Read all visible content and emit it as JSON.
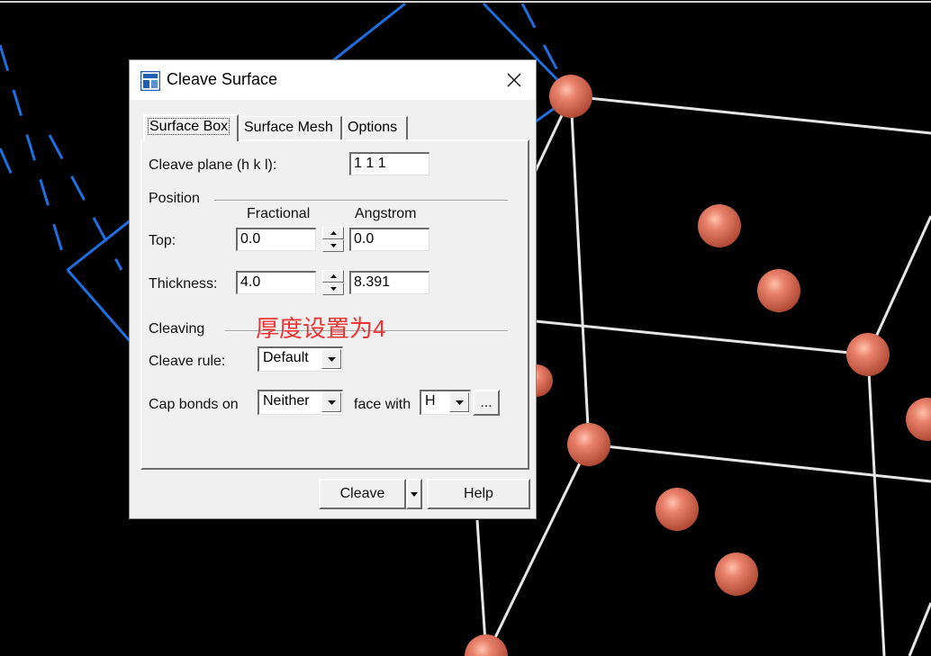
{
  "dialog": {
    "title": "Cleave Surface",
    "tabs": [
      {
        "label": "Surface Box",
        "active": true
      },
      {
        "label": "Surface Mesh",
        "active": false
      },
      {
        "label": "Options",
        "active": false
      }
    ],
    "cleave_plane": {
      "label": "Cleave plane (h k l):",
      "value": "1  1  1"
    },
    "position": {
      "section_label": "Position",
      "col_fractional": "Fractional",
      "col_angstrom": "Angstrom",
      "top": {
        "label": "Top:",
        "fractional": "0.0",
        "angstrom": "0.0"
      },
      "thickness": {
        "label": "Thickness:",
        "fractional": "4.0",
        "angstrom": "8.391"
      }
    },
    "cleaving": {
      "section_label": "Cleaving",
      "annotation": "厚度设置为4",
      "rule": {
        "label": "Cleave rule:",
        "value": "Default"
      },
      "cap_bonds": {
        "label": "Cap bonds on",
        "value": "Neither",
        "face_label": "face with",
        "face_value": "H",
        "more_label": "..."
      }
    },
    "buttons": {
      "cleave": "Cleave",
      "help": "Help"
    }
  },
  "colors": {
    "background": "#000000",
    "atom": "#e07a60",
    "bond": "#e6e6e6",
    "plane": "#1e6fe0",
    "annotation": "#ee3333"
  }
}
